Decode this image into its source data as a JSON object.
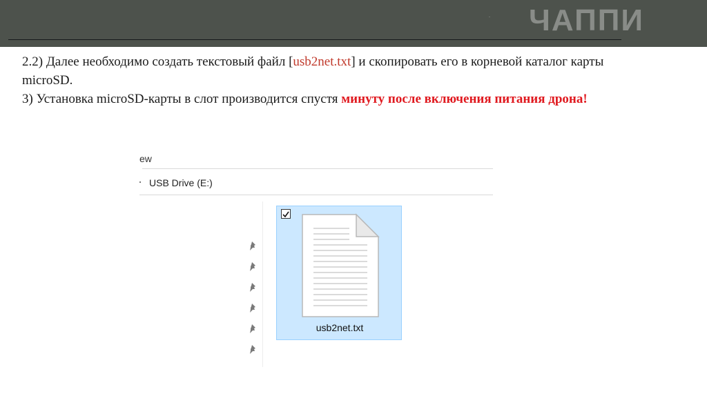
{
  "header": {
    "brand": "ЧАППИ"
  },
  "content": {
    "line1_a": "2.2) Далее необходимо создать текстовый файл [",
    "line1_link": "usb2net.txt",
    "line1_b": "] и скопировать его в корневой каталог карты microSD.",
    "line2_a": "3) Установка microSD-карты в слот производится спустя ",
    "line2_red": "минуту после включения питания дрона!"
  },
  "explorer": {
    "menu_fragment": "ew",
    "address": "USB Drive (E:)",
    "file_name": "usb2net.txt",
    "file_checked": true,
    "selection_color": "#cce8ff",
    "pin_icon": "pin-icon",
    "document_icon": "text-document-icon"
  },
  "colors": {
    "header_bg": "#4d524c",
    "brand": "#898c88",
    "highlight_red": "#e0191f"
  }
}
